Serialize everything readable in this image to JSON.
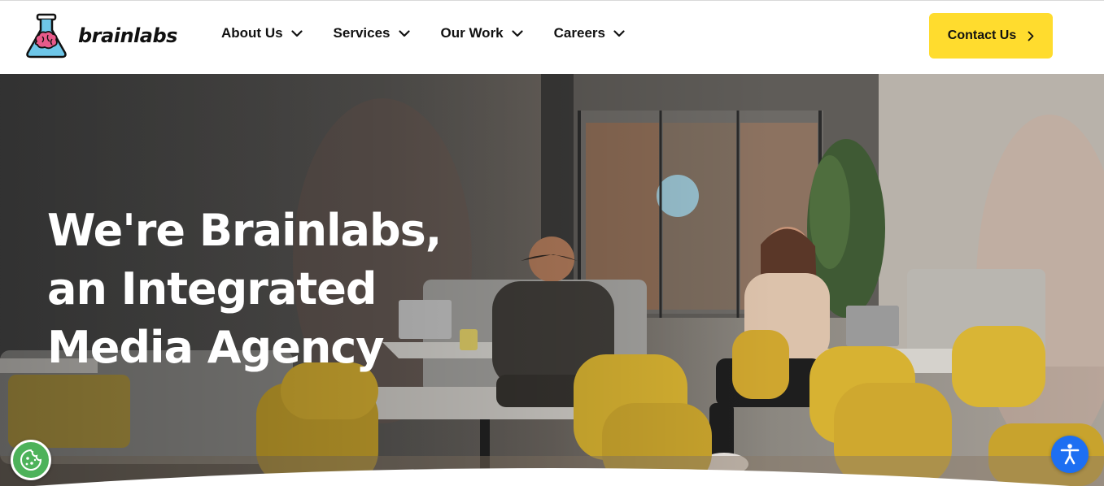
{
  "brand": {
    "name": "brainlabs",
    "logo_icon": "flask-brain-icon",
    "colors": {
      "accent": "#ffdc2e",
      "flask": "#6ec6e8",
      "brain": "#e85a8a"
    }
  },
  "nav": {
    "items": [
      {
        "label": "About Us",
        "icon": "chevron-down-icon"
      },
      {
        "label": "Services",
        "icon": "chevron-down-icon"
      },
      {
        "label": "Our Work",
        "icon": "chevron-down-icon"
      },
      {
        "label": "Careers",
        "icon": "chevron-down-icon"
      }
    ],
    "contact": {
      "label": "Contact Us",
      "icon": "chevron-right-icon"
    }
  },
  "hero": {
    "headline_lines": [
      "We're Brainlabs,",
      "an Integrated",
      "Media Agency"
    ],
    "image": "office-lounge-photo"
  },
  "widgets": {
    "cookie": {
      "icon": "cookie-icon",
      "color": "#4db25a"
    },
    "accessibility": {
      "icon": "accessibility-icon",
      "color": "#1d6ff2"
    }
  }
}
